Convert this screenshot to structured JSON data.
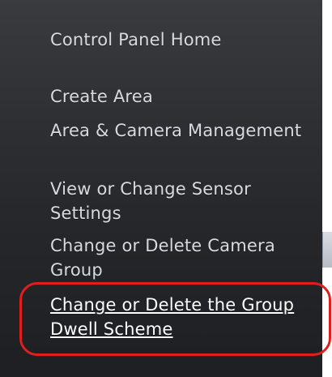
{
  "panel": {
    "items": [
      {
        "label": "Control Panel Home"
      },
      {
        "label": "Create Area"
      },
      {
        "label": "Area & Camera Management"
      },
      {
        "label": "View or Change Sensor Settings"
      },
      {
        "label": "Change or Delete Camera Group"
      },
      {
        "label": "Change or Delete the Group Dwell Scheme"
      }
    ]
  },
  "colors": {
    "panel_background": "#2f3033",
    "link_text": "#d7dbe1",
    "active_link_text": "#ffffff",
    "highlight_outline": "#e21d1d"
  }
}
